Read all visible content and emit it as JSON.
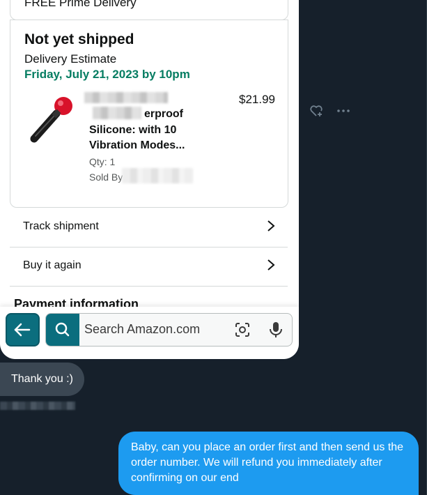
{
  "amazon_screenshot": {
    "top_partial_text": "FREE Prime Delivery",
    "shipment": {
      "status_title": "Not yet shipped",
      "estimate_label": "Delivery Estimate",
      "estimate_date": "Friday, July 21, 2023 by 10pm",
      "price": "$21.99",
      "product_name_line1": "erproof",
      "product_name_line2": "Silicone: with 10",
      "product_name_line3": "Vibration Modes...",
      "quantity": "Qty: 1",
      "sold_by_label": "Sold By"
    },
    "rows": [
      {
        "label": "Track shipment"
      },
      {
        "label": "Buy it again"
      }
    ],
    "payment_heading": "Payment information",
    "search": {
      "placeholder": "Search Amazon.com"
    }
  },
  "chat": {
    "incoming_message": "Thank you :)",
    "outgoing_message": "Baby, can you place an order first and then send us the order number. We will refund you immediately after confirming on our end"
  },
  "colors": {
    "background": "#16202b",
    "outgoing_bubble": "#1d9bf0",
    "incoming_bubble": "#3b4753",
    "amazon_teal": "#0b6e7e",
    "delivery_green": "#067d62"
  },
  "icons": [
    "back-arrow-icon",
    "search-icon",
    "camera-icon",
    "microphone-icon",
    "chevron-right-icon",
    "heart-plus-icon",
    "more-icon"
  ]
}
